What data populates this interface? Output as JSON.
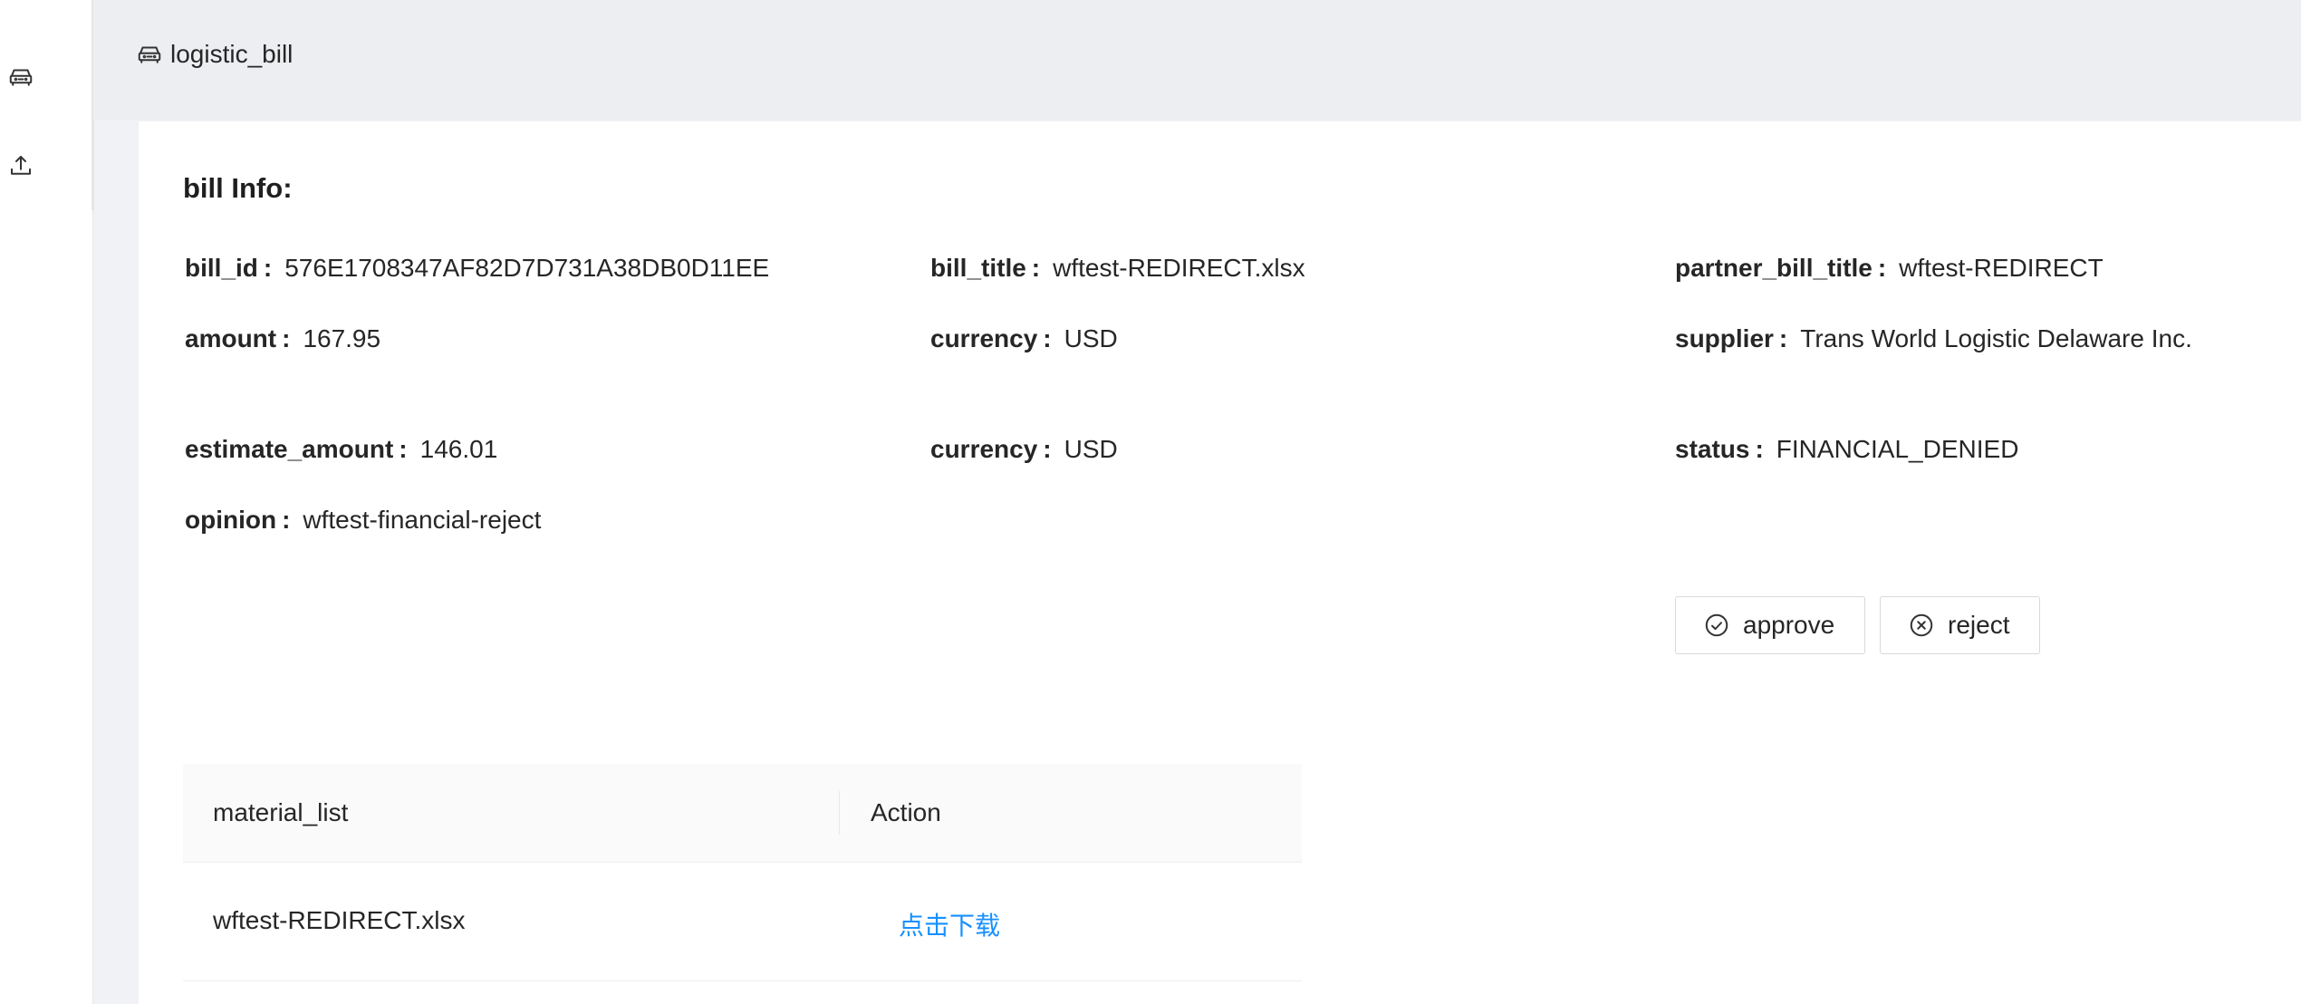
{
  "sidebar": {
    "items": [
      {
        "icon": "car-icon"
      },
      {
        "icon": "upload-icon"
      }
    ]
  },
  "breadcrumb": {
    "icon": "car-icon",
    "label": "logistic_bill"
  },
  "bill_info": {
    "title": "bill Info:",
    "fields": {
      "bill_id": {
        "label": "bill_id",
        "value": "576E1708347AF82D7D731A38DB0D11EE"
      },
      "bill_title": {
        "label": "bill_title",
        "value": "wftest-REDIRECT.xlsx"
      },
      "partner_bill_title": {
        "label": "partner_bill_title",
        "value": "wftest-REDIRECT"
      },
      "amount": {
        "label": "amount",
        "value": "167.95"
      },
      "currency": {
        "label": "currency",
        "value": "USD"
      },
      "supplier": {
        "label": "supplier",
        "value": "Trans World Logistic Delaware Inc."
      },
      "estimate_amount": {
        "label": "estimate_amount",
        "value": "146.01"
      },
      "estimate_currency": {
        "label": "currency",
        "value": "USD"
      },
      "status": {
        "label": "status",
        "value": "FINANCIAL_DENIED"
      },
      "opinion": {
        "label": "opinion",
        "value": "wftest-financial-reject"
      }
    },
    "colon": ":"
  },
  "actions": {
    "approve_label": "approve",
    "reject_label": "reject"
  },
  "material_table": {
    "columns": [
      "material_list",
      "Action"
    ],
    "rows": [
      {
        "file": "wftest-REDIRECT.xlsx",
        "action": "点击下载"
      }
    ]
  },
  "colors": {
    "link": "#1890ff",
    "background": "#f0f2f5",
    "header_bg": "#eceef2"
  }
}
